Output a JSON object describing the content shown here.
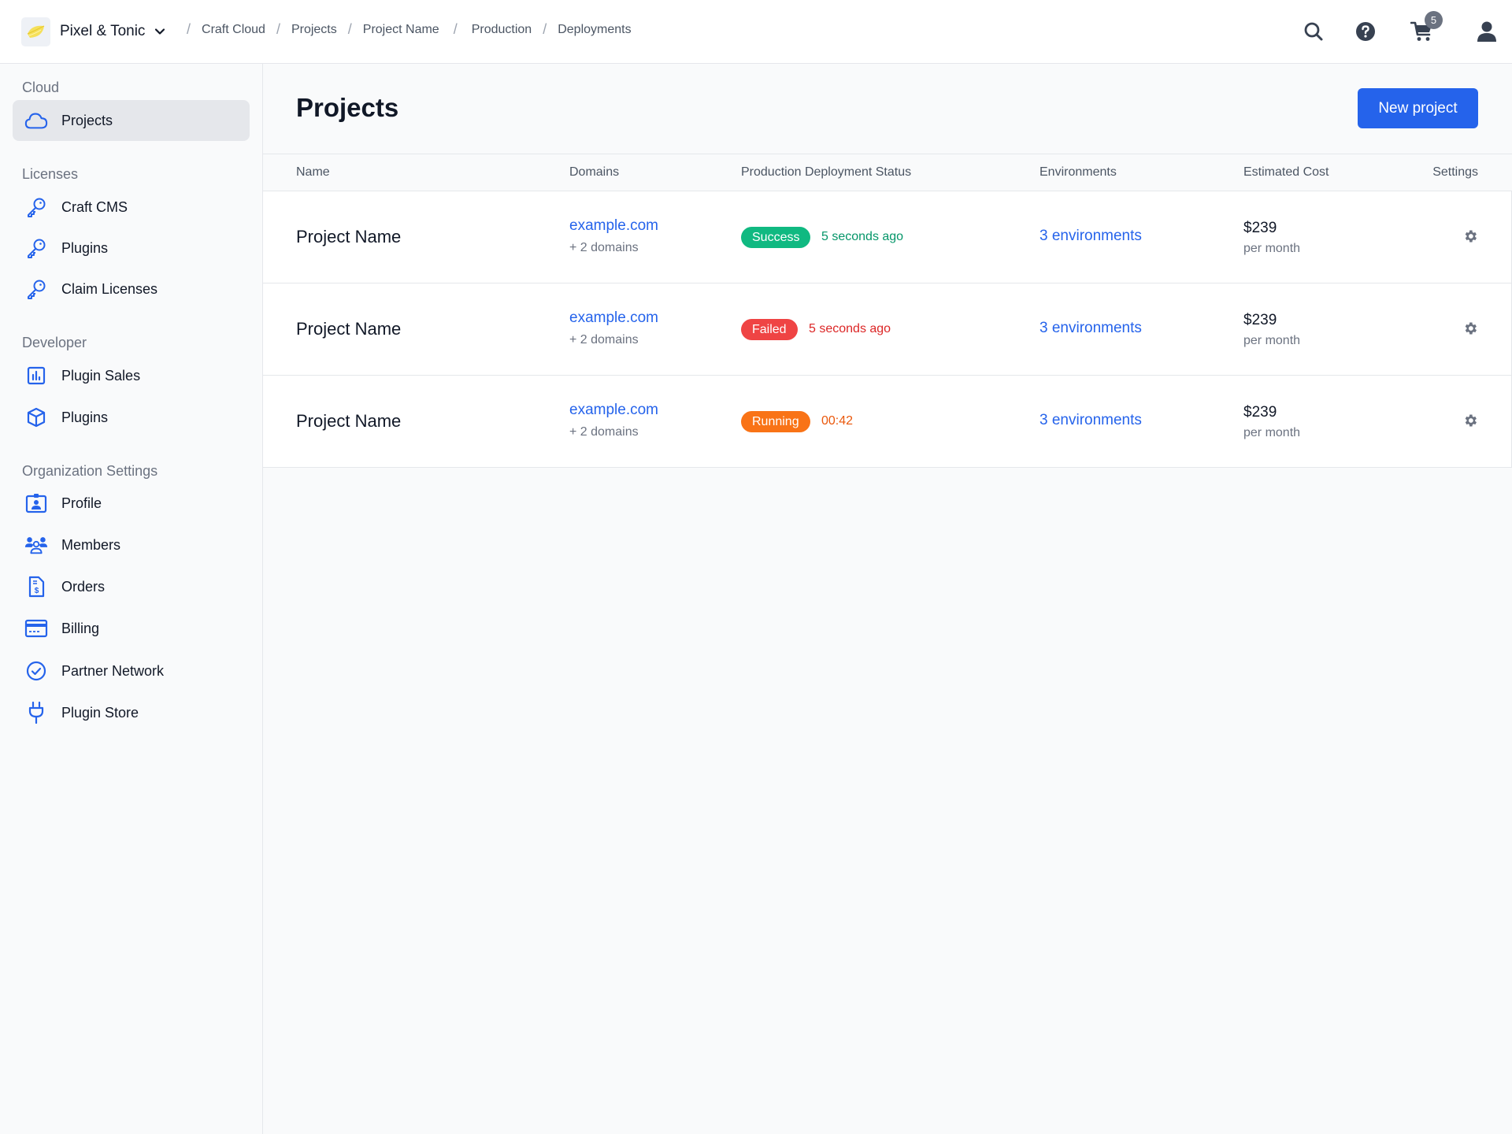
{
  "header": {
    "org_name": "Pixel & Tonic",
    "breadcrumb": [
      "Craft Cloud",
      "Projects",
      "Project Name",
      "Production",
      "Deployments"
    ],
    "cart_count": "5",
    "icons": [
      "search-icon",
      "help-icon",
      "cart-icon",
      "user-icon"
    ]
  },
  "sidebar": {
    "sections": [
      {
        "heading": "Cloud",
        "items": [
          {
            "label": "Projects",
            "icon": "cloud-icon",
            "active": true
          }
        ]
      },
      {
        "heading": "Licenses",
        "items": [
          {
            "label": "Craft CMS",
            "icon": "key-icon"
          },
          {
            "label": "Plugins",
            "icon": "key-icon"
          },
          {
            "label": "Claim Licenses",
            "icon": "key-icon"
          }
        ]
      },
      {
        "heading": "Developer",
        "items": [
          {
            "label": "Plugin Sales",
            "icon": "chart-icon"
          },
          {
            "label": "Plugins",
            "icon": "cube-icon"
          }
        ]
      },
      {
        "heading": "Organization Settings",
        "items": [
          {
            "label": "Profile",
            "icon": "id-badge-icon"
          },
          {
            "label": "Members",
            "icon": "users-icon"
          },
          {
            "label": "Orders",
            "icon": "invoice-icon"
          },
          {
            "label": "Billing",
            "icon": "credit-card-icon"
          },
          {
            "label": "Partner Network",
            "icon": "check-circle-icon"
          },
          {
            "label": "Plugin Store",
            "icon": "plug-icon"
          }
        ]
      }
    ]
  },
  "main": {
    "title": "Projects",
    "new_project_label": "New project",
    "columns": [
      "Name",
      "Domains",
      "Production Deployment Status",
      "Environments",
      "Estimated Cost",
      "Settings"
    ],
    "rows": [
      {
        "name": "Project Name",
        "domain": "example.com",
        "more_domains": "+ 2 domains",
        "status": "Success",
        "status_detail": "5 seconds ago",
        "status_color": "#10b981",
        "detail_color": "#059669",
        "environments": "3 environments",
        "cost": "$239",
        "cost_period": "per month"
      },
      {
        "name": "Project Name",
        "domain": "example.com",
        "more_domains": "+ 2 domains",
        "status": "Failed",
        "status_detail": "5 seconds ago",
        "status_color": "#ef4444",
        "detail_color": "#dc2626",
        "environments": "3 environments",
        "cost": "$239",
        "cost_period": "per month"
      },
      {
        "name": "Project Name",
        "domain": "example.com",
        "more_domains": "+ 2 domains",
        "status": "Running",
        "status_detail": "00:42",
        "status_color": "#f97316",
        "detail_color": "#ea580c",
        "environments": "3 environments",
        "cost": "$239",
        "cost_period": "per month"
      }
    ]
  },
  "colors": {
    "accent": "#2563eb",
    "icon_blue": "#2563eb",
    "icon_gray": "#4b5563"
  }
}
